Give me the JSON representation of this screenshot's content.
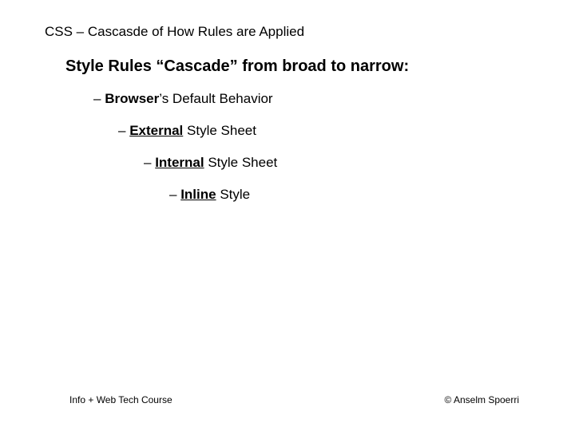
{
  "title": "CSS – Cascasde of How Rules are Applied",
  "heading": "Style Rules “Cascade” from broad to narrow:",
  "bullets": {
    "dash1": "–  ",
    "browser_bold": "Browser",
    "browser_rest": "’s Default Behavior",
    "dash2": "– ",
    "external_bold": "External",
    "external_rest": " Style Sheet",
    "dash3": "– ",
    "internal_bold": "Internal",
    "internal_rest": " Style Sheet",
    "dash4": "– ",
    "inline_bold": "Inline",
    "inline_rest": " Style"
  },
  "footer": {
    "left": "Info + Web Tech Course",
    "right": "© Anselm Spoerri"
  }
}
